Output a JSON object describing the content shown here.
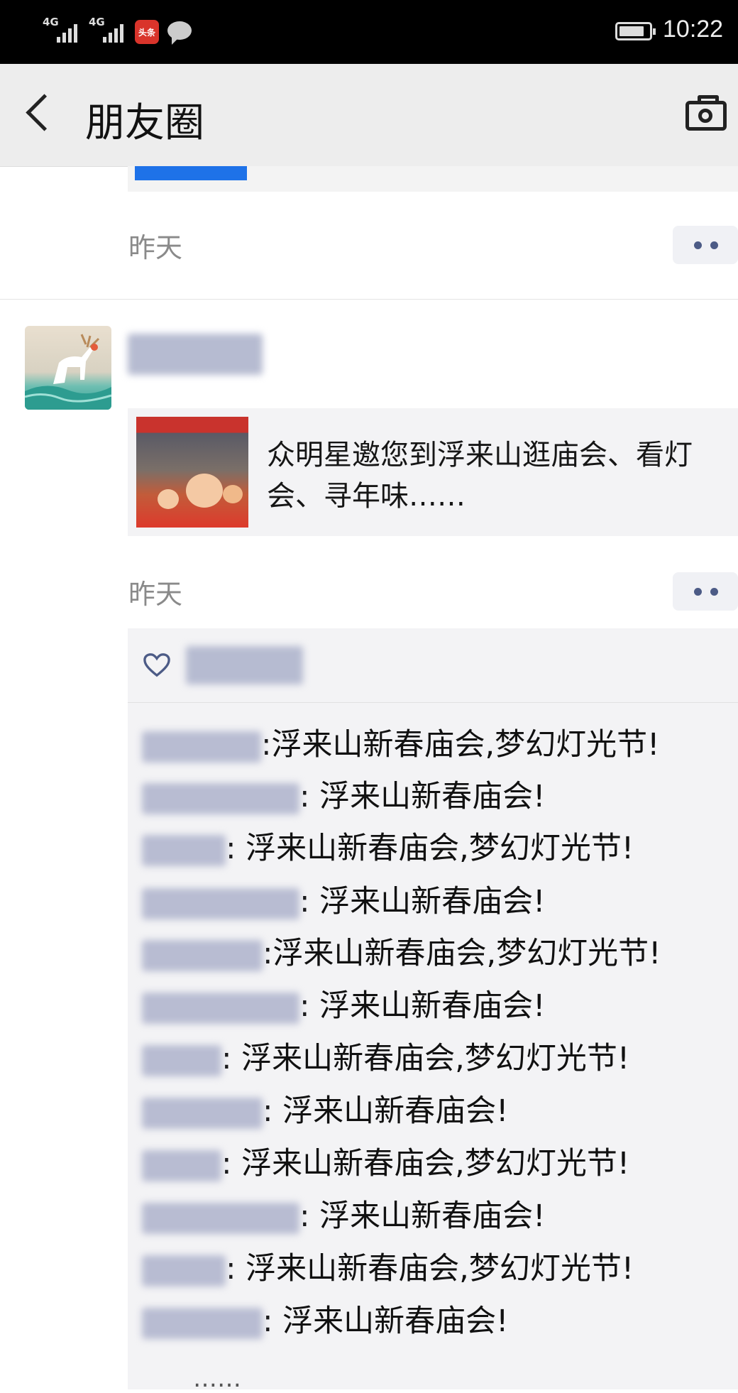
{
  "status_bar": {
    "signal_1": "4G",
    "signal_2": "4G",
    "app_badge": "头条",
    "time": "10:22",
    "battery_level": 0.85
  },
  "nav": {
    "title": "朋友圈",
    "back_icon": "chevron-left-icon",
    "camera_icon": "camera-icon"
  },
  "posts": [
    {
      "time": "昨天",
      "more_icon": "more-dots-icon"
    },
    {
      "share_text": "众明星邀您到浮来山逛庙会、看灯会、寻年味……",
      "time": "昨天",
      "more_icon": "more-dots-icon",
      "like_icon": "heart-icon",
      "comments": [
        {
          "text": ":浮来山新春庙会,梦幻灯光节!"
        },
        {
          "text": ": 浮来山新春庙会!"
        },
        {
          "text": ": 浮来山新春庙会,梦幻灯光节!"
        },
        {
          "text": ": 浮来山新春庙会!"
        },
        {
          "text": ":浮来山新春庙会,梦幻灯光节!"
        },
        {
          "text": ": 浮来山新春庙会!"
        },
        {
          "text": ": 浮来山新春庙会,梦幻灯光节!"
        },
        {
          "text": ": 浮来山新春庙会!"
        },
        {
          "text": ": 浮来山新春庙会,梦幻灯光节!"
        },
        {
          "text": ": 浮来山新春庙会!"
        },
        {
          "text": ": 浮来山新春庙会,梦幻灯光节!"
        },
        {
          "text": ": 浮来山新春庙会!"
        }
      ],
      "more_comments": "……"
    }
  ]
}
